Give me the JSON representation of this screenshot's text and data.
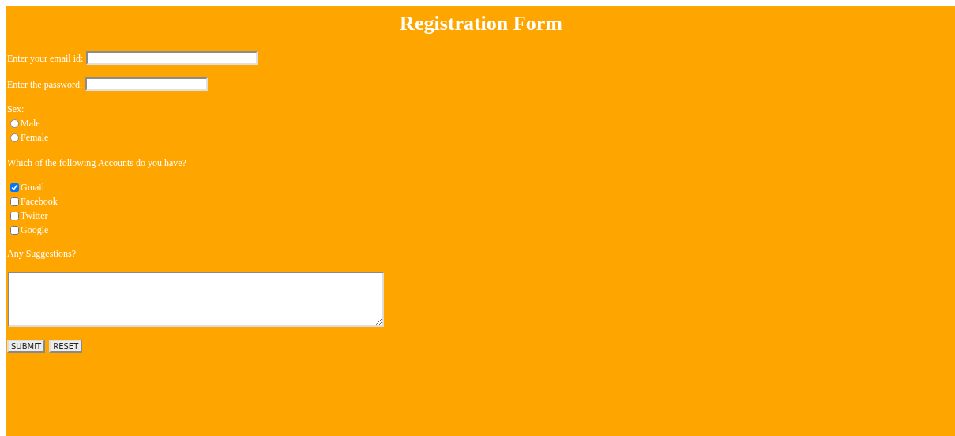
{
  "title": "Registration Form",
  "fields": [
    {
      "label": "Enter your email id:",
      "kind": "text"
    },
    {
      "label": "Enter the password:",
      "kind": "password"
    }
  ],
  "sex": {
    "label": "Sex:",
    "options": [
      {
        "label": "Male",
        "selected": false
      },
      {
        "label": "Female",
        "selected": false
      }
    ]
  },
  "accounts": {
    "question": "Which of the following Accounts do you have?",
    "options": [
      {
        "label": "Gmail",
        "checked": true
      },
      {
        "label": "Facebook",
        "checked": false
      },
      {
        "label": "Twitter",
        "checked": false
      },
      {
        "label": "Google",
        "checked": false
      }
    ]
  },
  "suggestions": {
    "label": "Any Suggestions?"
  },
  "buttons": [
    "SUBMIT",
    "RESET"
  ]
}
